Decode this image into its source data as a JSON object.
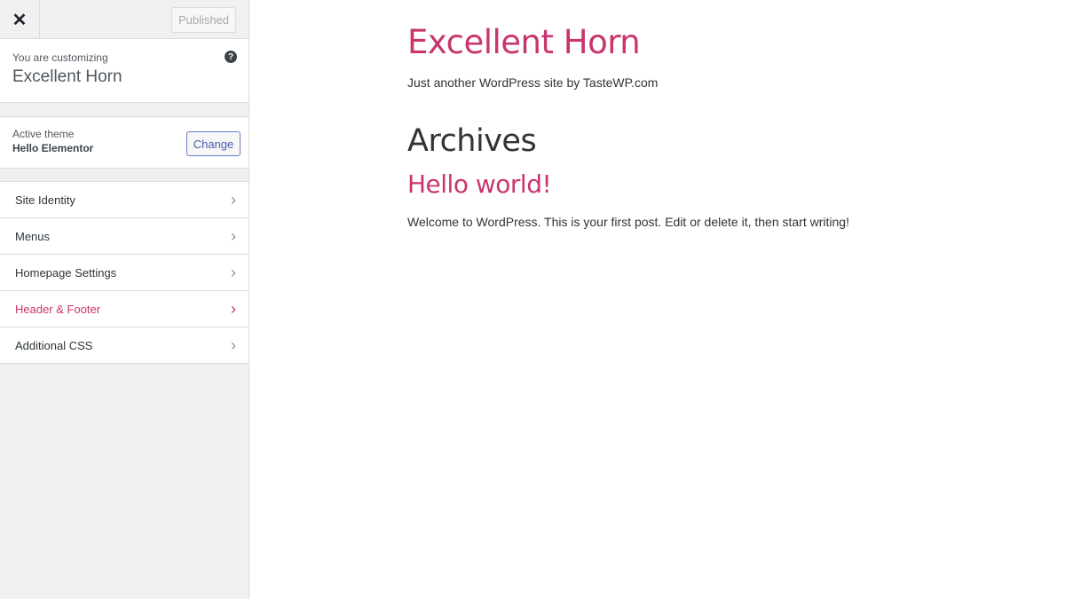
{
  "sidebar": {
    "close_label": "✕",
    "publish_label": "Published",
    "customizing_label": "You are customizing",
    "site_name": "Excellent Horn",
    "help_label": "?",
    "active_theme_label": "Active theme",
    "theme_name": "Hello Elementor",
    "change_label": "Change",
    "items": [
      {
        "label": "Site Identity"
      },
      {
        "label": "Menus"
      },
      {
        "label": "Homepage Settings"
      },
      {
        "label": "Header & Footer"
      },
      {
        "label": "Additional CSS"
      }
    ],
    "chevron": "›",
    "accent_color": "#c9356e"
  },
  "preview": {
    "site_title": "Excellent Horn",
    "tagline": "Just another WordPress site by TasteWP.com",
    "page_heading": "Archives",
    "post_title": "Hello world!",
    "excerpt": "Welcome to WordPress. This is your first post. Edit or delete it, then start writing!"
  }
}
